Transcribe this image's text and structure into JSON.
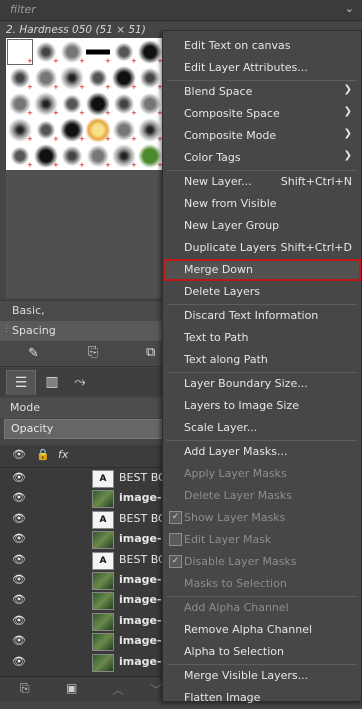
{
  "filter": {
    "placeholder": "filter"
  },
  "brushes": {
    "selected_title": "2. Hardness 050 (51 × 51)",
    "preset_label": "Basic,",
    "spacing_label": "Spacing"
  },
  "layers": {
    "mode_label": "Mode",
    "opacity_label": "Opacity",
    "fx_label": "fx",
    "items": [
      {
        "name": "BEST BC",
        "type": "text",
        "bold": false
      },
      {
        "name": "image-C",
        "type": "image",
        "bold": true
      },
      {
        "name": "BEST BC",
        "type": "text",
        "bold": false
      },
      {
        "name": "image-C",
        "type": "image",
        "bold": true
      },
      {
        "name": "BEST BC",
        "type": "text",
        "bold": false
      },
      {
        "name": "image-C",
        "type": "image",
        "bold": true
      },
      {
        "name": "image-C",
        "type": "image",
        "bold": true
      },
      {
        "name": "image-C",
        "type": "image",
        "bold": true
      },
      {
        "name": "image-C",
        "type": "image",
        "bold": true
      },
      {
        "name": "image-C",
        "type": "image",
        "bold": true
      }
    ]
  },
  "context_menu": {
    "items": [
      {
        "label": "Edit Text on canvas",
        "enabled": true
      },
      {
        "label": "Edit Layer Attributes...",
        "enabled": true
      },
      {
        "label": "Blend Space",
        "enabled": true,
        "submenu": true
      },
      {
        "label": "Composite Space",
        "enabled": true,
        "submenu": true
      },
      {
        "label": "Composite Mode",
        "enabled": true,
        "submenu": true
      },
      {
        "label": "Color Tags",
        "enabled": true,
        "submenu": true
      },
      {
        "label": "New Layer...",
        "shortcut": "Shift+Ctrl+N",
        "enabled": true
      },
      {
        "label": "New from Visible",
        "enabled": true
      },
      {
        "label": "New Layer Group",
        "enabled": true
      },
      {
        "label": "Duplicate Layers",
        "shortcut": "Shift+Ctrl+D",
        "enabled": true
      },
      {
        "label": "Merge Down",
        "enabled": true,
        "highlighted": true
      },
      {
        "label": "Delete Layers",
        "enabled": true
      },
      {
        "label": "Discard Text Information",
        "enabled": true
      },
      {
        "label": "Text to Path",
        "enabled": true
      },
      {
        "label": "Text along Path",
        "enabled": true
      },
      {
        "label": "Layer Boundary Size...",
        "enabled": true
      },
      {
        "label": "Layers to Image Size",
        "enabled": true
      },
      {
        "label": "Scale Layer...",
        "enabled": true
      },
      {
        "label": "Add Layer Masks...",
        "enabled": true
      },
      {
        "label": "Apply Layer Masks",
        "enabled": false
      },
      {
        "label": "Delete Layer Masks",
        "enabled": false
      },
      {
        "label": "Show Layer Masks",
        "enabled": false,
        "checkbox": true,
        "checked": true
      },
      {
        "label": "Edit Layer Mask",
        "enabled": false,
        "checkbox": true,
        "checked": false
      },
      {
        "label": "Disable Layer Masks",
        "enabled": false,
        "checkbox": true,
        "checked": true
      },
      {
        "label": "Masks to Selection",
        "enabled": false
      },
      {
        "label": "Add Alpha Channel",
        "enabled": false
      },
      {
        "label": "Remove Alpha Channel",
        "enabled": true
      },
      {
        "label": "Alpha to Selection",
        "enabled": true
      },
      {
        "label": "Merge Visible Layers...",
        "enabled": true
      },
      {
        "label": "Flatten Image",
        "enabled": true
      }
    ]
  },
  "colors": {
    "highlight_outline": "#c01818",
    "menu_bg": "#474747",
    "panel_bg": "#454545"
  },
  "icons": [
    "chevron-down-icon",
    "eye-icon",
    "lock-icon",
    "text-layer-icon",
    "image-layer-icon",
    "submenu-arrow-icon",
    "checkbox-icon"
  ]
}
